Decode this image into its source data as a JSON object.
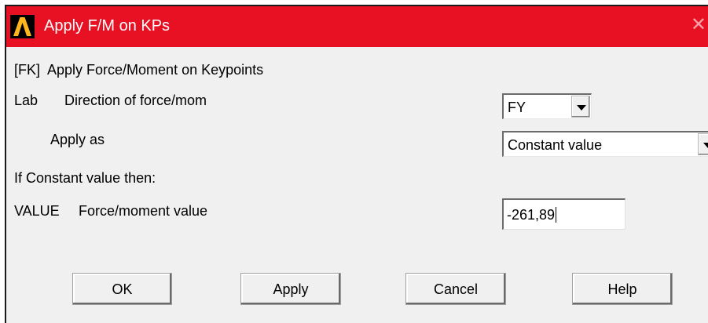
{
  "window": {
    "title": "Apply F/M on KPs",
    "close_glyph": "✕"
  },
  "form": {
    "header": "[FK]  Apply Force/Moment on Keypoints",
    "lab_code": "Lab",
    "lab_desc": "Direction of force/mom",
    "lab_value": "FY",
    "apply_as_label": "Apply as",
    "apply_as_value": "Constant value",
    "if_constant_label": "If Constant value then:",
    "value_code": "VALUE",
    "value_desc": "Force/moment value",
    "value_input": "-261,89"
  },
  "buttons": {
    "ok": "OK",
    "apply": "Apply",
    "cancel": "Cancel",
    "help": "Help"
  },
  "colors": {
    "titlebar": "#e81123",
    "dialog_bg": "#f0f0f0"
  },
  "icons": {
    "app": "ansys-logo-icon",
    "close": "close-icon",
    "dropdown": "chevron-down-icon"
  }
}
